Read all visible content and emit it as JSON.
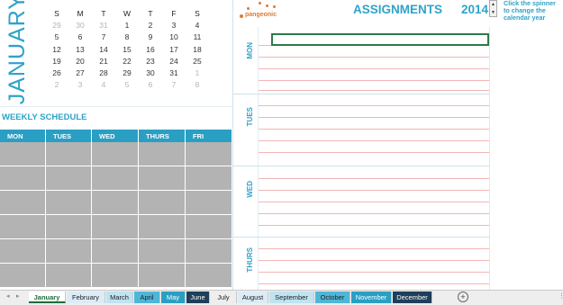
{
  "calendar": {
    "month": "JANUARY",
    "headers": [
      "S",
      "M",
      "T",
      "W",
      "T",
      "F",
      "S"
    ],
    "weeks": [
      [
        {
          "d": "29",
          "m": true
        },
        {
          "d": "30",
          "m": true
        },
        {
          "d": "31",
          "m": true
        },
        {
          "d": "1"
        },
        {
          "d": "2"
        },
        {
          "d": "3"
        },
        {
          "d": "4"
        }
      ],
      [
        {
          "d": "5"
        },
        {
          "d": "6"
        },
        {
          "d": "7"
        },
        {
          "d": "8"
        },
        {
          "d": "9"
        },
        {
          "d": "10"
        },
        {
          "d": "11"
        }
      ],
      [
        {
          "d": "12"
        },
        {
          "d": "13"
        },
        {
          "d": "14"
        },
        {
          "d": "15"
        },
        {
          "d": "16"
        },
        {
          "d": "17"
        },
        {
          "d": "18"
        }
      ],
      [
        {
          "d": "19"
        },
        {
          "d": "20"
        },
        {
          "d": "21"
        },
        {
          "d": "22"
        },
        {
          "d": "23"
        },
        {
          "d": "24"
        },
        {
          "d": "25"
        }
      ],
      [
        {
          "d": "26"
        },
        {
          "d": "27"
        },
        {
          "d": "28"
        },
        {
          "d": "29"
        },
        {
          "d": "30"
        },
        {
          "d": "31"
        },
        {
          "d": "1",
          "m": true
        }
      ],
      [
        {
          "d": "2",
          "m": true
        },
        {
          "d": "3",
          "m": true
        },
        {
          "d": "4",
          "m": true
        },
        {
          "d": "5",
          "m": true
        },
        {
          "d": "6",
          "m": true
        },
        {
          "d": "7",
          "m": true
        },
        {
          "d": "8",
          "m": true
        }
      ]
    ]
  },
  "weekly": {
    "title": "WEEKLY SCHEDULE",
    "days": [
      "MON",
      "TUES",
      "WED",
      "THURS",
      "FRI"
    ]
  },
  "header": {
    "logo_text": "pangeonic",
    "title": "ASSIGNMENTS",
    "year": "2014",
    "spinner_up": "▲",
    "spinner_down": "▼",
    "hint": "Click the spinner to change the calendar year"
  },
  "assignments": {
    "days": [
      "MON",
      "TUES",
      "WED",
      "THURS"
    ]
  },
  "sheet_tabs": [
    {
      "label": "January",
      "bg": "#ffffff",
      "fg": "#1f6b3a",
      "active": true
    },
    {
      "label": "February",
      "bg": "#dcecf7",
      "fg": "#222222"
    },
    {
      "label": "March",
      "bg": "#bfe3f1",
      "fg": "#222222"
    },
    {
      "label": "April",
      "bg": "#4fb6d8",
      "fg": "#222222"
    },
    {
      "label": "May",
      "bg": "#2a9fc4",
      "fg": "#ffffff"
    },
    {
      "label": "June",
      "bg": "#1f3f5a",
      "fg": "#ffffff"
    },
    {
      "label": "July",
      "bg": "#eeeeee",
      "fg": "#222222"
    },
    {
      "label": "August",
      "bg": "#dcecf7",
      "fg": "#222222"
    },
    {
      "label": "September",
      "bg": "#bfe3f1",
      "fg": "#222222"
    },
    {
      "label": "October",
      "bg": "#4fb6d8",
      "fg": "#222222"
    },
    {
      "label": "November",
      "bg": "#2a9fc4",
      "fg": "#ffffff"
    },
    {
      "label": "December",
      "bg": "#1f3f5a",
      "fg": "#ffffff"
    }
  ],
  "icons": {
    "prev_sheet": "◂",
    "next_sheet": "▸",
    "add_sheet": "+",
    "more_options": "⋮"
  }
}
